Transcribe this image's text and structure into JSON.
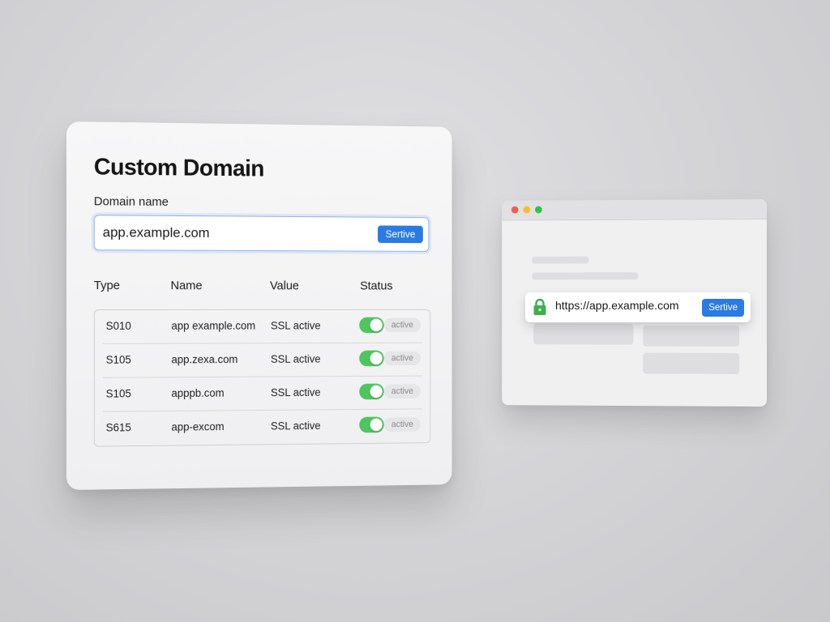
{
  "panel": {
    "title": "Custom Domain",
    "field_label": "Domain name",
    "domain_input": {
      "value": "app.example.com",
      "button_label": "Sertive"
    },
    "columns": [
      "Type",
      "Name",
      "Value",
      "Status"
    ],
    "rows": [
      {
        "type": "S010",
        "name": "app example.com",
        "value": "SSL active",
        "status": "active",
        "enabled": true
      },
      {
        "type": "S105",
        "name": "app.zexa.com",
        "value": "SSL active",
        "status": "active",
        "enabled": true
      },
      {
        "type": "S105",
        "name": "apppb.com",
        "value": "SSL active",
        "status": "active",
        "enabled": true
      },
      {
        "type": "S615",
        "name": "app-excom",
        "value": "SSL active",
        "status": "active",
        "enabled": true
      }
    ]
  },
  "browser": {
    "window_controls": [
      "close",
      "minimize",
      "maximize"
    ],
    "address": {
      "icon": "lock-icon",
      "url": "https://app.example.com",
      "button_label": "Sertive"
    }
  },
  "colors": {
    "accent": "#2a7be4",
    "toggle_on": "#4fc55f",
    "lock": "#3db04c",
    "close": "#ec5f57",
    "minimize": "#f4be2f",
    "maximize": "#2fc447"
  }
}
